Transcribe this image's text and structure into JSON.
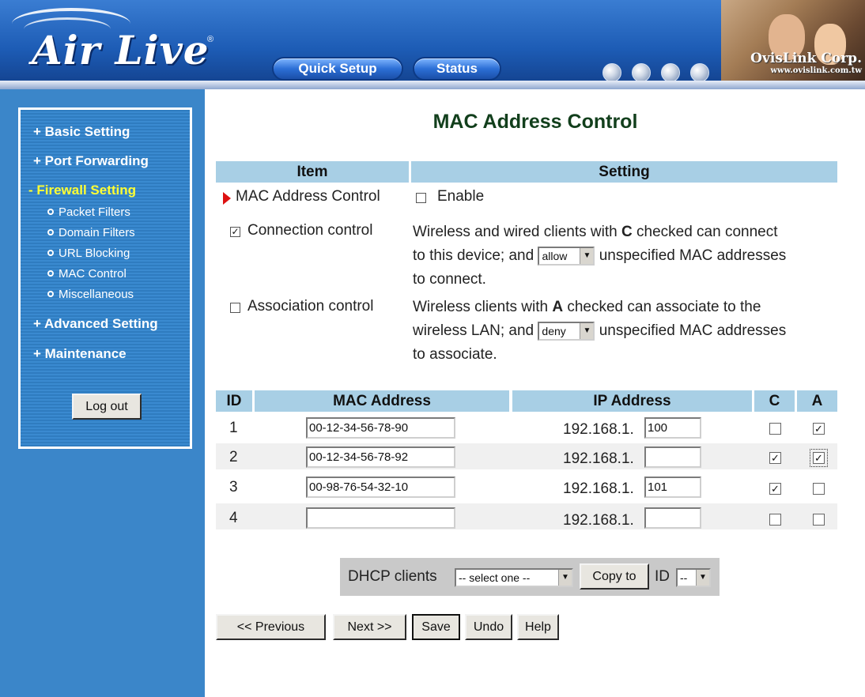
{
  "header": {
    "logo_text": "Air Live",
    "logo_mark": "®",
    "quick_setup_label": "Quick Setup",
    "status_label": "Status",
    "company_name": "OvisLink Corp.",
    "company_url": "www.ovislink.com.tw",
    "globe_icons": [
      "globe-icon",
      "globe-icon",
      "globe-icon",
      "globe-icon"
    ]
  },
  "sidebar": {
    "items": [
      {
        "label": "+ Basic Setting",
        "active": false
      },
      {
        "label": "+ Port Forwarding",
        "active": false
      },
      {
        "label": "- Firewall Setting",
        "active": true
      },
      {
        "label": "+ Advanced Setting",
        "active": false
      },
      {
        "label": "+ Maintenance",
        "active": false
      }
    ],
    "subitems": [
      "Packet Filters",
      "Domain Filters",
      "URL Blocking",
      "MAC Control",
      "Miscellaneous"
    ],
    "logout_label": "Log out"
  },
  "main": {
    "title": "MAC Address Control",
    "settings_header": {
      "item": "Item",
      "setting": "Setting"
    },
    "mac_control_label": "MAC Address Control",
    "enable_label": "Enable",
    "enable_checked": false,
    "connection_control": {
      "label": "Connection control",
      "checked": true,
      "text_before": "Wireless and wired clients with",
      "letter": "C",
      "text_after": "checked can connect",
      "line2_before": "to this device; and",
      "select_value": "allow",
      "line2_after": "unspecified MAC addresses",
      "line3": "to connect."
    },
    "association_control": {
      "label": "Association control",
      "checked": false,
      "text_before": "Wireless clients with",
      "letter": "A",
      "text_after": "checked can associate to the",
      "line2_before": "wireless LAN; and",
      "select_value": "deny",
      "line2_after": "unspecified MAC addresses",
      "line3": "to associate."
    },
    "table": {
      "headers": {
        "id": "ID",
        "mac": "MAC Address",
        "ip": "IP Address",
        "c": "C",
        "a": "A"
      },
      "ip_prefix": "192.168.1.",
      "rows": [
        {
          "id": "1",
          "mac": "00-12-34-56-78-90",
          "ip_suffix": "100",
          "c": false,
          "a": true
        },
        {
          "id": "2",
          "mac": "00-12-34-56-78-92",
          "ip_suffix": "",
          "c": true,
          "a": true
        },
        {
          "id": "3",
          "mac": "00-98-76-54-32-10",
          "ip_suffix": "101",
          "c": true,
          "a": false
        },
        {
          "id": "4",
          "mac": "",
          "ip_suffix": "",
          "c": false,
          "a": false
        }
      ]
    },
    "dhcp": {
      "label": "DHCP clients",
      "select_value": "-- select one --",
      "copy_label": "Copy to",
      "id_label": "ID",
      "id_value": "--"
    },
    "buttons": {
      "previous": "<< Previous",
      "next": "Next >>",
      "save": "Save",
      "undo": "Undo",
      "help": "Help"
    },
    "colors": {
      "header_bar": "#a8cfe5",
      "sidebar": "#3b86c9",
      "active_nav": "#ffff33",
      "title": "#123f1c",
      "arrow": "#d11"
    }
  }
}
